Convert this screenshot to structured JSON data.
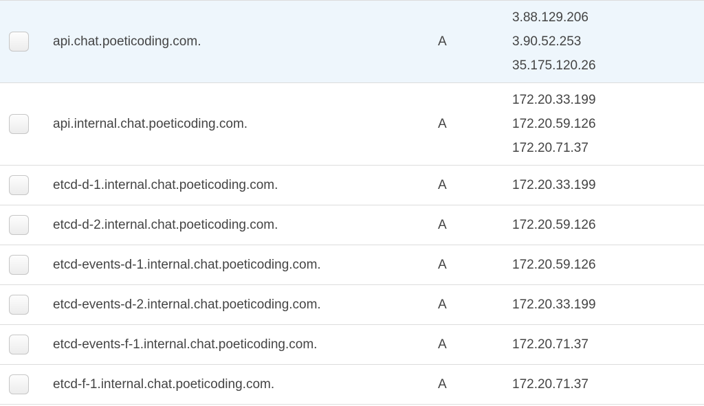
{
  "records": [
    {
      "name": "api.chat.poeticoding.com.",
      "type": "A",
      "values": [
        "3.88.129.206",
        "3.90.52.253",
        "35.175.120.26"
      ],
      "selected": true
    },
    {
      "name": "api.internal.chat.poeticoding.com.",
      "type": "A",
      "values": [
        "172.20.33.199",
        "172.20.59.126",
        "172.20.71.37"
      ],
      "selected": false
    },
    {
      "name": "etcd-d-1.internal.chat.poeticoding.com.",
      "type": "A",
      "values": [
        "172.20.33.199"
      ],
      "selected": false
    },
    {
      "name": "etcd-d-2.internal.chat.poeticoding.com.",
      "type": "A",
      "values": [
        "172.20.59.126"
      ],
      "selected": false
    },
    {
      "name": "etcd-events-d-1.internal.chat.poeticoding.com.",
      "type": "A",
      "values": [
        "172.20.59.126"
      ],
      "selected": false
    },
    {
      "name": "etcd-events-d-2.internal.chat.poeticoding.com.",
      "type": "A",
      "values": [
        "172.20.33.199"
      ],
      "selected": false
    },
    {
      "name": "etcd-events-f-1.internal.chat.poeticoding.com.",
      "type": "A",
      "values": [
        "172.20.71.37"
      ],
      "selected": false
    },
    {
      "name": "etcd-f-1.internal.chat.poeticoding.com.",
      "type": "A",
      "values": [
        "172.20.71.37"
      ],
      "selected": false
    }
  ],
  "colors": {
    "selected_row_bg": "#eef6fc",
    "border": "#dcdcdc",
    "text": "#444444"
  }
}
